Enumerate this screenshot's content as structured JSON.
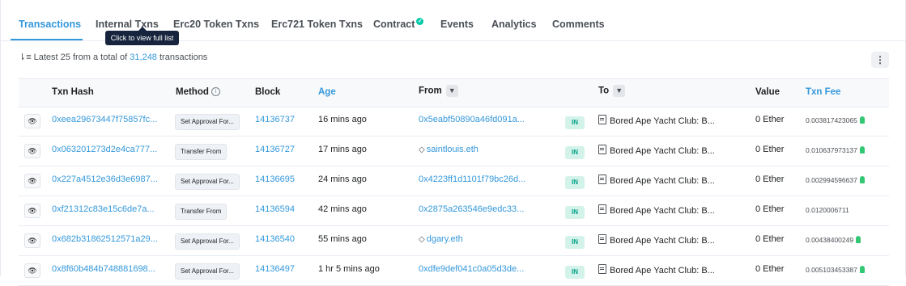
{
  "tabs": [
    {
      "label": "Transactions",
      "active": true
    },
    {
      "label": "Internal Txns"
    },
    {
      "label": "Erc20 Token Txns"
    },
    {
      "label": "Erc721 Token Txns"
    },
    {
      "label": "Contract",
      "verified_icon": "check-circle-icon"
    },
    {
      "label": "Events"
    },
    {
      "label": "Analytics"
    },
    {
      "label": "Comments"
    }
  ],
  "tooltip": "Click to view full list",
  "summary": {
    "prefix": "Latest 25 from a total of",
    "count": "31,248",
    "suffix": "transactions",
    "sort_icon": "sort-descending-icon"
  },
  "more_button": "⋮",
  "columns": {
    "hash": "Txn Hash",
    "method": "Method",
    "block": "Block",
    "age": "Age",
    "from": "From",
    "to": "To",
    "value": "Value",
    "fee": "Txn Fee"
  },
  "rows": [
    {
      "hash": "0xeea29673447f75857fc...",
      "method": "Set Approval For...",
      "block": "14136737",
      "age": "16 mins ago",
      "from": "0x5eabf50890a46fd091a...",
      "from_ens": false,
      "direction": "IN",
      "to": "Bored Ape Yacht Club: B...",
      "value": "0 Ether",
      "fee": "0.003817423065",
      "fee_icon": true
    },
    {
      "hash": "0x063201273d2e4ca777...",
      "method": "Transfer From",
      "block": "14136727",
      "age": "17 mins ago",
      "from": "saintlouis.eth",
      "from_ens": true,
      "direction": "IN",
      "to": "Bored Ape Yacht Club: B...",
      "value": "0 Ether",
      "fee": "0.010637973137",
      "fee_icon": true
    },
    {
      "hash": "0x227a4512e36d3e6987...",
      "method": "Set Approval For...",
      "block": "14136695",
      "age": "24 mins ago",
      "from": "0x4223ff1d1101f79bc26d...",
      "from_ens": false,
      "direction": "IN",
      "to": "Bored Ape Yacht Club: B...",
      "value": "0 Ether",
      "fee": "0.002994596637",
      "fee_icon": true
    },
    {
      "hash": "0xf21312c83e15c6de7a...",
      "method": "Transfer From",
      "block": "14136594",
      "age": "42 mins ago",
      "from": "0x2875a263546e9edc33...",
      "from_ens": false,
      "direction": "IN",
      "to": "Bored Ape Yacht Club: B...",
      "value": "0 Ether",
      "fee": "0.0120006711",
      "fee_icon": false
    },
    {
      "hash": "0x682b31862512571a29...",
      "method": "Set Approval For...",
      "block": "14136540",
      "age": "55 mins ago",
      "from": "dgary.eth",
      "from_ens": true,
      "direction": "IN",
      "to": "Bored Ape Yacht Club: B...",
      "value": "0 Ether",
      "fee": "0.00438400249",
      "fee_icon": true
    },
    {
      "hash": "0x8f60b484b748881698...",
      "method": "Set Approval For...",
      "block": "14136497",
      "age": "1 hr 5 mins ago",
      "from": "0xdfe9def041c0a05d3de...",
      "from_ens": false,
      "direction": "IN",
      "to": "Bored Ape Yacht Club: B...",
      "value": "0 Ether",
      "fee": "0.005103453387",
      "fee_icon": true
    }
  ]
}
